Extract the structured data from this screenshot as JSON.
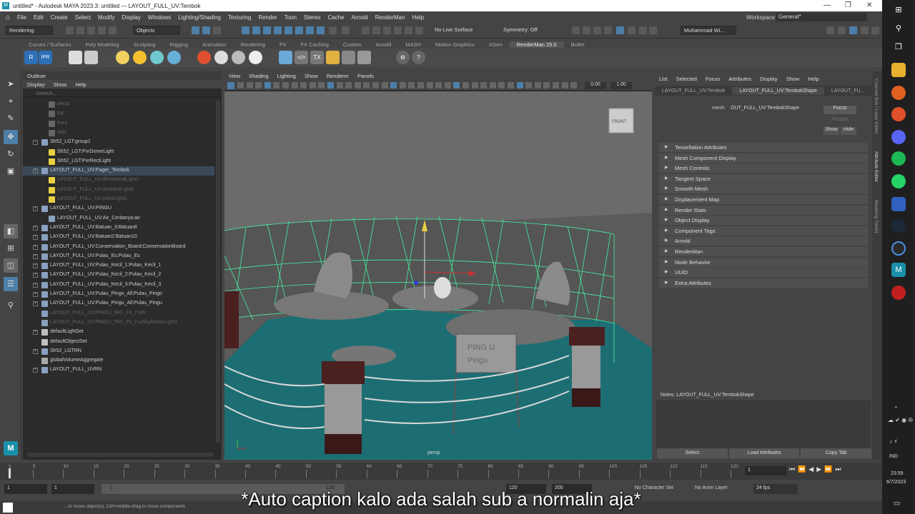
{
  "titlebar": {
    "title": "untitled* - Autodesk MAYA 2023.3: untitled  ---  LAYOUT_FULL_UV:Tembok",
    "min": "—",
    "max": "❐",
    "close": "✕"
  },
  "menubar": [
    "File",
    "Edit",
    "Create",
    "Select",
    "Modify",
    "Display",
    "Windows",
    "Lighting/Shading",
    "Texturing",
    "Render",
    "Toon",
    "Stereo",
    "Cache",
    "Arnold",
    "RenderMan",
    "Help"
  ],
  "workspace": {
    "label": "Workspace:",
    "value": "General*"
  },
  "status": {
    "menuset": "Rendering",
    "selmode": "Objects",
    "live": "No Live Surface",
    "symmetry": "Symmetry: Off",
    "user": "Muhammad Wi..."
  },
  "shelf_tabs": [
    "Curves / Surfaces",
    "Poly Modeling",
    "Sculpting",
    "Rigging",
    "Animation",
    "Rendering",
    "FX",
    "FX Caching",
    "Custom",
    "Arnold",
    "MASH",
    "Motion Graphics",
    "XGen",
    "RenderMan 25.0",
    "Bullet"
  ],
  "shelf_active": "RenderMan 25.0",
  "outliner": {
    "tab": "Outliner",
    "menu": [
      "Display",
      "Show",
      "Help"
    ],
    "search_placeholder": "Search...",
    "items": [
      {
        "label": "persp",
        "dim": true,
        "depth": 1,
        "icon": "camera"
      },
      {
        "label": "top",
        "dim": true,
        "depth": 1,
        "icon": "camera"
      },
      {
        "label": "front",
        "dim": true,
        "depth": 1,
        "icon": "camera"
      },
      {
        "label": "side",
        "dim": true,
        "depth": 1,
        "icon": "camera"
      },
      {
        "label": "Sh52_LGT:group1",
        "depth": 0,
        "icon": "group",
        "exp": "−"
      },
      {
        "label": "Sh52_LGT:PxrDomeLight",
        "depth": 1,
        "icon": "light"
      },
      {
        "label": "Sh52_LGT:PxrRectLight",
        "depth": 1,
        "icon": "light"
      },
      {
        "label": "LAYOUT_FULL_UV:Pager_Tembok",
        "depth": 0,
        "icon": "group",
        "exp": "+",
        "sel": true
      },
      {
        "label": "LAYOUT_FULL_UV:directionalLight1",
        "dim": true,
        "depth": 1,
        "icon": "light"
      },
      {
        "label": "LAYOUT_FULL_UV:ambientLight1",
        "dim": true,
        "depth": 1,
        "icon": "light"
      },
      {
        "label": "LAYOUT_FULL_UV:pointLight1",
        "dim": true,
        "depth": 1,
        "icon": "light"
      },
      {
        "label": "LAYOUT_FULL_UV:PINGU",
        "depth": 0,
        "icon": "group",
        "exp": "+"
      },
      {
        "label": "LAYOUT_FULL_UV:Air_Ceritanya:air",
        "depth": 1,
        "icon": "group"
      },
      {
        "label": "LAYOUT_FULL_UV:Batuan_3:Batuan8",
        "depth": 0,
        "icon": "group",
        "exp": "+"
      },
      {
        "label": "LAYOUT_FULL_UV:Batuan2:Batuan10",
        "depth": 0,
        "icon": "group",
        "exp": "+"
      },
      {
        "label": "LAYOUT_FULL_UV:Conservation_Board:ConservationBoard",
        "depth": 0,
        "icon": "group",
        "exp": "+"
      },
      {
        "label": "LAYOUT_FULL_UV:Pulau_Es:Pulau_Es",
        "depth": 0,
        "icon": "group",
        "exp": "+"
      },
      {
        "label": "LAYOUT_FULL_UV:Pulau_Kecil_1:Pulau_Kecil_1",
        "depth": 0,
        "icon": "group",
        "exp": "+"
      },
      {
        "label": "LAYOUT_FULL_UV:Pulau_Kecil_2:Pulau_Kecil_2",
        "depth": 0,
        "icon": "group",
        "exp": "+"
      },
      {
        "label": "LAYOUT_FULL_UV:Pulau_Kecil_3:Pulau_Kecil_3",
        "depth": 0,
        "icon": "group",
        "exp": "+"
      },
      {
        "label": "LAYOUT_FULL_UV:Pulau_Pingo_All:Pulau_Pingo",
        "depth": 0,
        "icon": "group",
        "exp": "+"
      },
      {
        "label": "LAYOUT_FULL_UV:Pulau_Pingu_All:Pulau_Pingu",
        "depth": 0,
        "icon": "group",
        "exp": "+"
      },
      {
        "label": "LAYOUT_FULL_UV:PINGU_RIG_Fit_2:left",
        "dim": true,
        "depth": 0,
        "icon": "group"
      },
      {
        "label": "LAYOUT_FULL_UV:PINGU_RIG_Fit_2:uiSkyDomeLight1",
        "dim": true,
        "depth": 0,
        "icon": "group"
      },
      {
        "label": "defaultLightSet",
        "depth": 0,
        "icon": "set",
        "exp": "+"
      },
      {
        "label": "defaultObjectSet",
        "depth": 0,
        "icon": "set"
      },
      {
        "label": "Sh52_LGTRN",
        "depth": 0,
        "icon": "rn",
        "exp": "+"
      },
      {
        "label": "globalVolumeAggregate",
        "depth": 0,
        "icon": "sphere"
      },
      {
        "label": "LAYOUT_FULL_UVRN",
        "depth": 0,
        "icon": "rn",
        "exp": "+"
      }
    ]
  },
  "viewport": {
    "menu": [
      "View",
      "Shading",
      "Lighting",
      "Show",
      "Renderer",
      "Panels"
    ],
    "cam": "persp",
    "front": "FRONT",
    "val1": "0.00",
    "val2": "1.00",
    "sign": "PING U\nPingu"
  },
  "attr": {
    "menu": [
      "List",
      "Selected",
      "Focus",
      "Attributes",
      "Display",
      "Show",
      "Help"
    ],
    "tabs": [
      "LAYOUT_FULL_UV:Tembok",
      "LAYOUT_FULL_UV:TembokShape",
      "LAYOUT_FU..."
    ],
    "mesh_label": "mesh:",
    "mesh_value": "OUT_FULL_UV:TembokShape",
    "focus": "Focus",
    "presets": "Presets",
    "show": "Show",
    "hide": "Hide",
    "sections": [
      "Tessellation Attributes",
      "Mesh Component Display",
      "Mesh Controls",
      "Tangent Space",
      "Smooth Mesh",
      "Displacement Map",
      "Render Stats",
      "Object Display",
      "Component Tags",
      "Arnold",
      "RenderMan",
      "Node Behavior",
      "UUID",
      "Extra Attributes"
    ],
    "notes": "Notes: LAYOUT_FULL_UV:TembokShape",
    "buttons": [
      "Select",
      "Load Attributes",
      "Copy Tab"
    ],
    "side_labels": [
      "Channel Box / Layer Editor",
      "Attribute Editor",
      "Modeling Toolkit"
    ]
  },
  "timeline": {
    "ticks": [
      "1",
      "5",
      "10",
      "15",
      "20",
      "25",
      "30",
      "35",
      "40",
      "45",
      "50",
      "55",
      "60",
      "65",
      "70",
      "75",
      "80",
      "85",
      "90",
      "95",
      "100",
      "105",
      "110",
      "115",
      "120"
    ],
    "current": "1"
  },
  "range": {
    "start": "1",
    "start2": "1",
    "slider_start": "1",
    "slider_end": "120",
    "end": "120",
    "end2": "200",
    "charset": "No Character Set",
    "animlayer": "No Anim Layer",
    "fps": "24 fps"
  },
  "cmd": {
    "hint": "...to move object(s). Ctrl+middle-drag to move components"
  },
  "caption": "*Auto caption kalo ada salah sub a normalin aja*",
  "clock": {
    "lang": "IND",
    "time": "23:59",
    "date": "6/7/2023"
  },
  "colors": {
    "wire": "#44f0a0",
    "water": "#1d6e73",
    "accent": "#4d7fa8"
  }
}
